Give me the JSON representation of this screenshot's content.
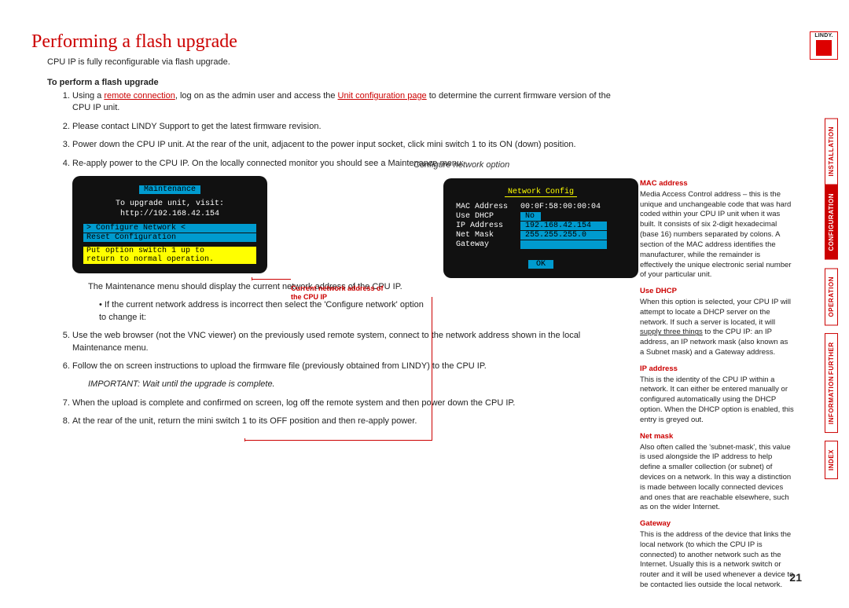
{
  "page": {
    "title": "Performing a flash upgrade",
    "intro": "CPU IP is fully reconfigurable via flash upgrade.",
    "sub_heading": "To perform a flash upgrade",
    "page_number": "21",
    "logo_text": "LINDY."
  },
  "steps": {
    "s1a": "Using a ",
    "s1_link1": "remote connection",
    "s1b": ", log on as the admin user and access the ",
    "s1_link2": "Unit configuration page",
    "s1c": " to determine the current firmware version of the CPU IP unit.",
    "s2": "Please contact LINDY Support to get the latest firmware revision.",
    "s3": "Power down the CPU IP unit. At the rear of the unit, adjacent to the power input socket, click mini switch 1 to its ON (down) position.",
    "s4": "Re-apply power to the CPU IP. On the locally connected monitor you should see a Maintenance menu:",
    "note1": "The Maintenance menu should display the current network address of the CPU IP.",
    "bullet1": "• If the current network address is incorrect then select the 'Configure network' option to change it:",
    "s5": "Use the web browser (not the VNC viewer) on the previously used remote system, connect to the network address shown in the local Maintenance menu.",
    "s6": "Follow the on screen instructions to upload the firmware file (previously obtained from LINDY) to the CPU IP.",
    "important": "IMPORTANT: Wait until the upgrade is complete.",
    "s7": "When the upload is complete and confirmed on screen, log off the remote system and then power down the CPU IP.",
    "s8": "At the rear of the unit, return the mini switch 1 to its OFF position and then re-apply power."
  },
  "term1": {
    "title": "Maintenance",
    "line1": "To upgrade unit, visit:",
    "line2": "http://192.168.42.154",
    "opt1": ">   Configure Network   <",
    "opt2": "  Reset Configuration",
    "y1": "Put option switch 1 up to",
    "y2": "return to normal operation."
  },
  "callout": "Current network address of the CPU IP",
  "cfg_label": "Configure network option",
  "term2": {
    "title": "Network Config",
    "mac_k": "MAC Address",
    "mac_v": "00:0F:58:00:00:04",
    "dhcp_k": "Use DHCP",
    "dhcp_v": "No",
    "ip_k": "IP Address",
    "ip_v": "192.168.42.154",
    "mask_k": "Net Mask",
    "mask_v": "255.255.255.0",
    "gw_k": "Gateway",
    "gw_v": "",
    "ok": "OK"
  },
  "rcol": {
    "mac_h": "MAC address",
    "mac_p": "Media Access Control address – this is the unique and unchangeable code that was hard coded within your CPU IP unit when it was built. It consists of six 2-digit hexadecimal (base 16) numbers separated by colons. A section of the MAC address identifies the manufacturer, while the remainder is effectively the unique electronic serial number of your particular unit.",
    "dhcp_h": "Use DHCP",
    "dhcp_p1": "When this option is selected, your CPU IP will attempt to locate a DHCP server on the network. If such a server is located, it will ",
    "dhcp_link": "supply three things",
    "dhcp_p2": " to the CPU IP: an IP address, an IP network mask (also known as a Subnet mask) and a Gateway address.",
    "ip_h": "IP address",
    "ip_p": "This is the identity of the CPU IP within a network. It can either be entered manually or configured automatically using the DHCP option. When the DHCP option is enabled, this entry is greyed out.",
    "mask_h": "Net mask",
    "mask_p": "Also often called the 'subnet-mask', this value is used alongside the IP address to help define a smaller collection (or subnet) of devices on a network. In this way a distinction is made between locally connected devices and ones that are reachable elsewhere, such as on the wider Internet.",
    "gw_h": "Gateway",
    "gw_p": "This is the address of the device that links the local network (to which the CPU IP is connected) to another network such as the Internet. Usually this is a network switch or router and it will be used whenever a device to be contacted lies outside the local network."
  },
  "tabs": {
    "t1": "INSTALLATION",
    "t2": "CONFIGURATION",
    "t3": "OPERATION",
    "t4a": "FURTHER",
    "t4b": "INFORMATION",
    "t5": "INDEX"
  }
}
